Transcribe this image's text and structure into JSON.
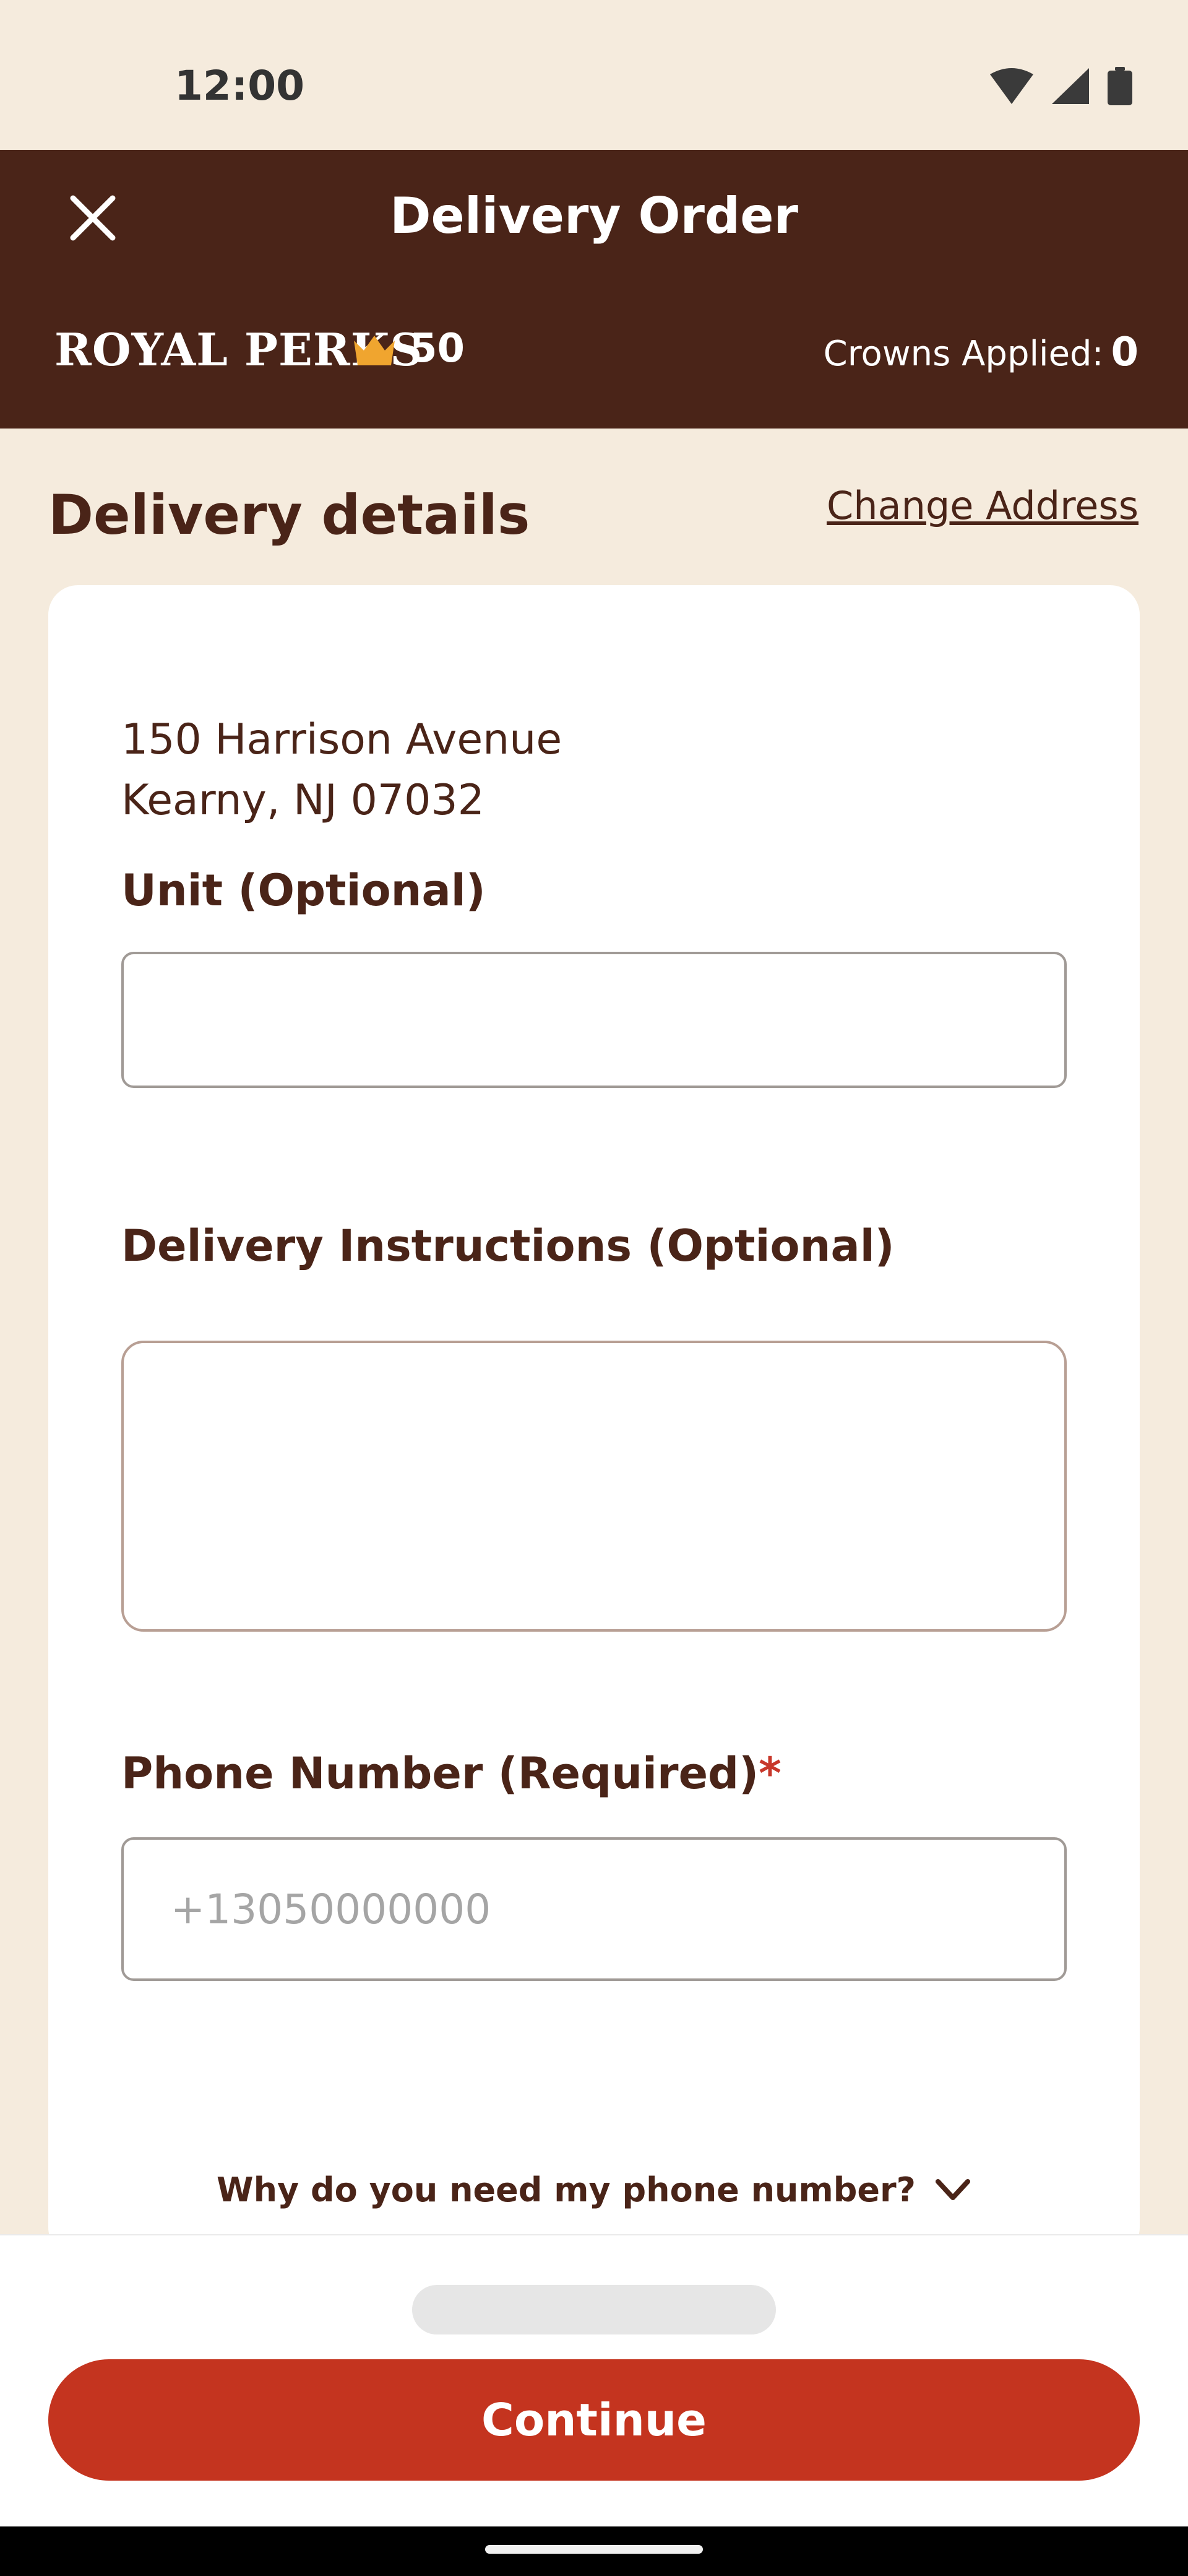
{
  "status_bar": {
    "time": "12:00"
  },
  "header": {
    "title": "Delivery Order",
    "close_icon": "close-icon"
  },
  "royal_perks": {
    "logo_text": "ROYAL PERKS",
    "points": "50",
    "crowns_applied_label": "Crowns Applied:",
    "crowns_applied_value": "0",
    "crown_color": "#F0A52F"
  },
  "delivery": {
    "title": "Delivery details",
    "change_address_label": "Change Address",
    "address_line1": "150 Harrison Avenue",
    "address_line2": "Kearny, NJ 07032",
    "unit_label": "Unit (Optional)",
    "unit_value": "",
    "instructions_label": "Delivery Instructions (Optional)",
    "instructions_value": "",
    "phone_label": "Phone Number (Required)",
    "phone_required_marker": "*",
    "phone_placeholder": "+13050000000",
    "phone_value": "",
    "why_phone_label": "Why do you need my phone number?"
  },
  "bottom": {
    "continue_label": "Continue"
  },
  "colors": {
    "brand_brown": "#4A2418",
    "background": "#F5EBDD",
    "accent_red": "#C4341F"
  }
}
